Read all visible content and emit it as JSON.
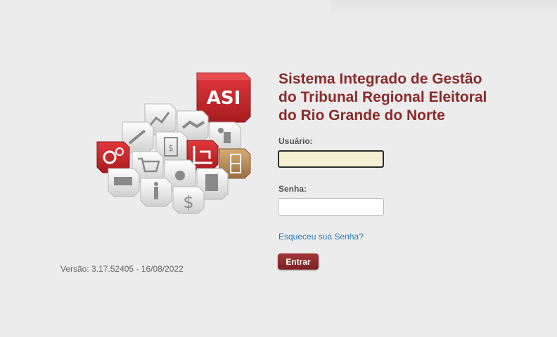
{
  "app": {
    "title_lines": [
      "Sistema Integrado de Gestão",
      "do Tribunal Regional Eleitoral",
      "do Rio Grande do Norte"
    ],
    "logo_text": "ASI",
    "version": "Versão: 3.17.52405 - 16/08/2022"
  },
  "login": {
    "username_label": "Usuário:",
    "username_value": "",
    "password_label": "Senha:",
    "password_value": "",
    "forgot_link": "Esqueceu sua Senha?",
    "submit_label": "Entrar"
  },
  "colors": {
    "brand": "#8a2a2b",
    "link": "#2a7ab8",
    "focused_input_bg": "#f5f0d3",
    "tile_red": "#c4262b",
    "tile_gold": "#b38a55"
  },
  "logo_tiles": [
    "chart-icon",
    "handshake-icon",
    "hand-truck-icon",
    "pencil-icon",
    "money-document-icon",
    "forklift-icon",
    "cabinet-icon",
    "gears-icon",
    "shopping-cart-icon",
    "badge-icon",
    "building-icon",
    "truck-icon",
    "person-icon",
    "dollar-icon"
  ]
}
